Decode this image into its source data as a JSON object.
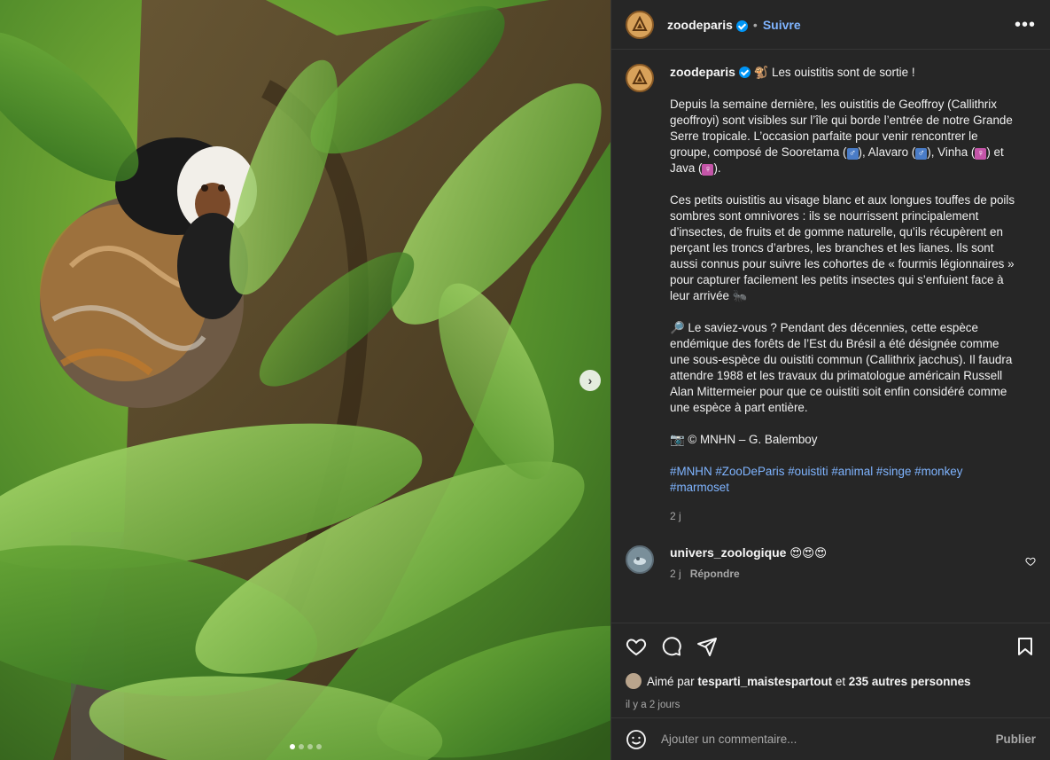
{
  "header": {
    "username": "zoodeparis",
    "separator": "•",
    "follow_label": "Suivre",
    "more_label": "•••"
  },
  "caption": {
    "username": "zoodeparis",
    "headline": "🐒 Les ouistitis sont de sortie !",
    "para1_a": "Depuis la semaine dernière, les ouistitis de Geoffroy (Callithrix geoffroyi) sont visibles sur l’île qui borde l’entrée de notre Grande Serre tropicale. L’occasion parfaite pour venir rencontrer le groupe, composé de Sooretama (",
    "male1": "♂",
    "para1_b": "), Alavaro (",
    "male2": "♂",
    "para1_c": "), Vinha (",
    "female1": "♀",
    "para1_d": ") et Java (",
    "female2": "♀",
    "para1_e": ").",
    "para2": "Ces petits ouistitis au visage blanc et aux longues touffes de poils sombres sont omnivores : ils se nourrissent principalement d’insectes, de fruits et de gomme naturelle, qu’ils récupèrent en perçant les troncs d’arbres, les branches et les lianes. Ils sont aussi connus pour suivre les cohortes de « fourmis légionnaires » pour capturer facilement les petits insectes qui s’enfuient face à leur arrivée 🐜",
    "para3": "🔎 Le saviez-vous ? Pendant des décennies, cette espèce endémique des forêts de l’Est du Brésil a été désignée comme une sous-espèce du ouistiti commun (Callithrix jacchus). Il faudra attendre 1988 et les travaux du primatologue américain Russell Alan Mittermeier pour que ce ouistiti soit enfin considéré comme une espèce à part entière.",
    "credit": "📷 © MNHN – G. Balemboy",
    "hashtags": "#MNHN #ZooDeParis #ouistiti #animal #singe #monkey #marmoset",
    "time": "2 j"
  },
  "comment": {
    "username": "univers_zoologique",
    "text": "😍😍😍",
    "time": "2 j",
    "reply_label": "Répondre"
  },
  "likes": {
    "prefix": "Aimé par",
    "user": "tesparti_maistespartout",
    "middle": "et",
    "others": "235 autres personnes"
  },
  "posted_ago": "il y a 2 jours",
  "add_comment": {
    "placeholder": "Ajouter un commentaire...",
    "publish_label": "Publier"
  },
  "carousel": {
    "slides": 4,
    "active_index": 0
  },
  "colors": {
    "background": "#262626",
    "link_blue": "#7fb4ff",
    "verified": "#0095f6"
  }
}
